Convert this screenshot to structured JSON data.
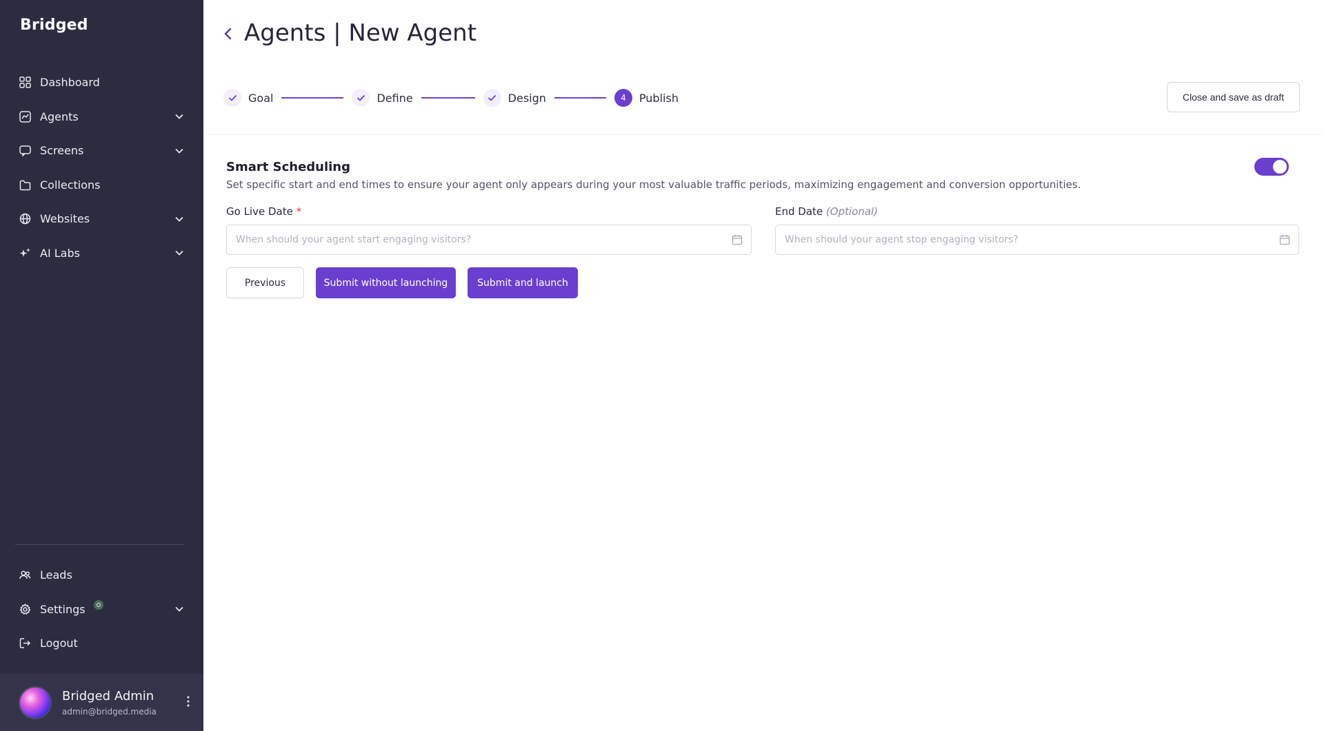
{
  "brand": {
    "logo": "Bridged"
  },
  "sidebar": {
    "items": [
      {
        "label": "Dashboard",
        "icon": "grid-icon"
      },
      {
        "label": "Agents",
        "icon": "chart-icon",
        "expandable": true
      },
      {
        "label": "Screens",
        "icon": "message-square-icon",
        "expandable": true
      },
      {
        "label": "Collections",
        "icon": "folder-icon"
      },
      {
        "label": "Websites",
        "icon": "globe-icon",
        "expandable": true
      },
      {
        "label": "AI Labs",
        "icon": "sparkles-icon",
        "expandable": true
      }
    ],
    "bottom_items": [
      {
        "label": "Leads",
        "icon": "users-icon"
      },
      {
        "label": "Settings",
        "icon": "gear-icon",
        "expandable": true
      },
      {
        "label": "Logout",
        "icon": "logout-icon"
      }
    ],
    "user": {
      "name": "Bridged Admin",
      "email": "admin@bridged.media"
    }
  },
  "header": {
    "title": "Agents | New Agent"
  },
  "stepper": {
    "steps": [
      {
        "label": "Goal",
        "status": "done"
      },
      {
        "label": "Define",
        "status": "done"
      },
      {
        "label": "Design",
        "status": "done"
      },
      {
        "label": "Publish",
        "status": "active",
        "number": "4"
      }
    ]
  },
  "actions": {
    "draft_label": "Close and save as draft"
  },
  "scheduling": {
    "title": "Smart Scheduling",
    "description": "Set specific start and end times to ensure your agent only appears during your most valuable traffic periods, maximizing engagement and conversion opportunities.",
    "enabled": true,
    "go_live": {
      "label": "Go Live Date",
      "required_mark": "*",
      "placeholder": "When should your agent start engaging visitors?",
      "value": ""
    },
    "end_date": {
      "label": "End Date",
      "optional_mark": "(Optional)",
      "placeholder": "When should your agent stop engaging visitors?",
      "value": ""
    }
  },
  "buttons": {
    "previous": "Previous",
    "submit_no_launch": "Submit without launching",
    "submit_launch": "Submit and launch"
  },
  "colors": {
    "sidebar_bg": "#2b2c40",
    "accent": "#6a3fd0"
  }
}
